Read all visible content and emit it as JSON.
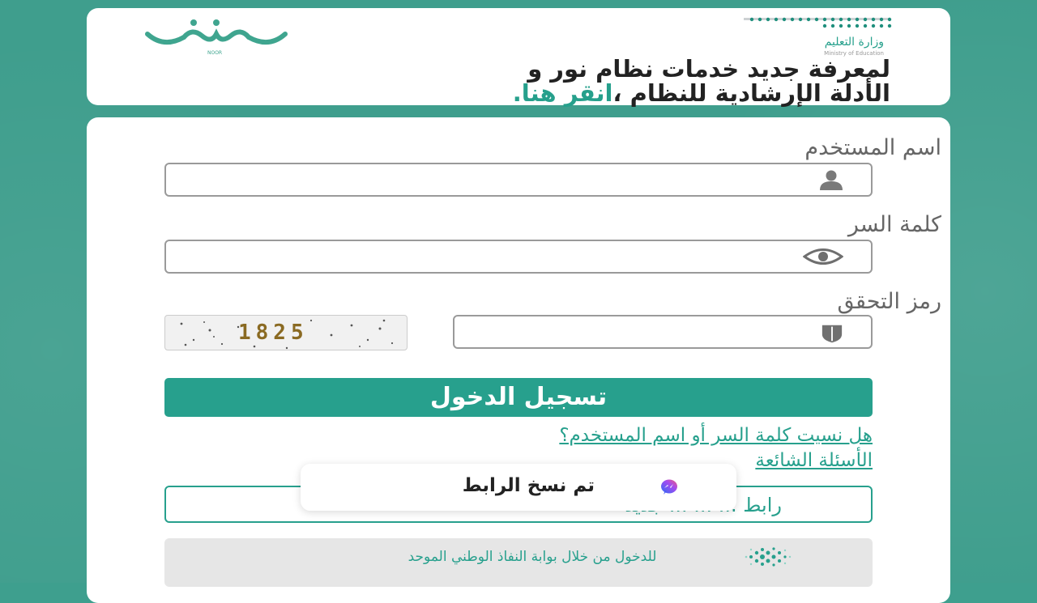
{
  "colors": {
    "brand": "#27a08d",
    "background": "#3f9e8d"
  },
  "header": {
    "ministry_ar": "وزارة التعليم",
    "ministry_en": "Ministry of Education",
    "noor_logo_text": "NOOR",
    "banner_line1": "لمعرفة جديد خدمات نظام نور و",
    "banner_line2_text": "الأدلة الإرشادية للنظام ،",
    "banner_link": "انقر هنا."
  },
  "login": {
    "username_label": "اسم المستخدم",
    "username_icon": "user-icon",
    "password_label": "كلمة السر",
    "password_icon": "eye-icon",
    "captcha_label": "رمز التحقق",
    "captcha_icon": "shield-icon",
    "captcha_value": "1825",
    "submit_label": "تسجيل الدخول",
    "forgot_link": "هل نسيت كلمة السر أو اسم المستخدم؟",
    "faq_link": "الأسئلة الشائعة",
    "register_label": "رابط ... ... ... جديد"
  },
  "toast": {
    "message": "تم نسخ الرابط",
    "icon": "messenger-icon"
  },
  "nafath": {
    "text": "للدخول من خلال بوابة النفاذ الوطني الموحد",
    "icon": "nafath-logo-icon"
  }
}
